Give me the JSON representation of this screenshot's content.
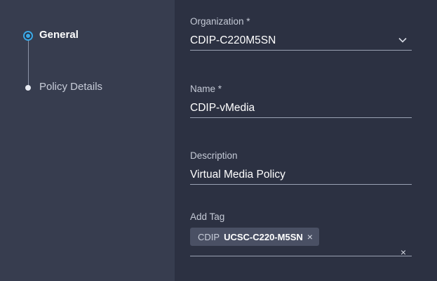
{
  "stepper": {
    "steps": [
      {
        "label": "General",
        "state": "active"
      },
      {
        "label": "Policy Details",
        "state": "inactive"
      }
    ]
  },
  "form": {
    "organization": {
      "label": "Organization *",
      "value": "CDIP-C220M5SN",
      "icon": "chevron-down-icon"
    },
    "name": {
      "label": "Name *",
      "value": "CDIP-vMedia"
    },
    "description": {
      "label": "Description",
      "value": "Virtual Media Policy"
    },
    "tags": {
      "label": "Add Tag",
      "items": [
        {
          "key": "CDIP",
          "value": "UCSC-C220-M5SN",
          "remove": "×"
        }
      ],
      "clear": "×"
    }
  },
  "colors": {
    "sidebar_bg": "#373d4f",
    "main_bg": "#2c3142",
    "accent": "#3aa8e6",
    "chip_bg": "#4a5064"
  }
}
